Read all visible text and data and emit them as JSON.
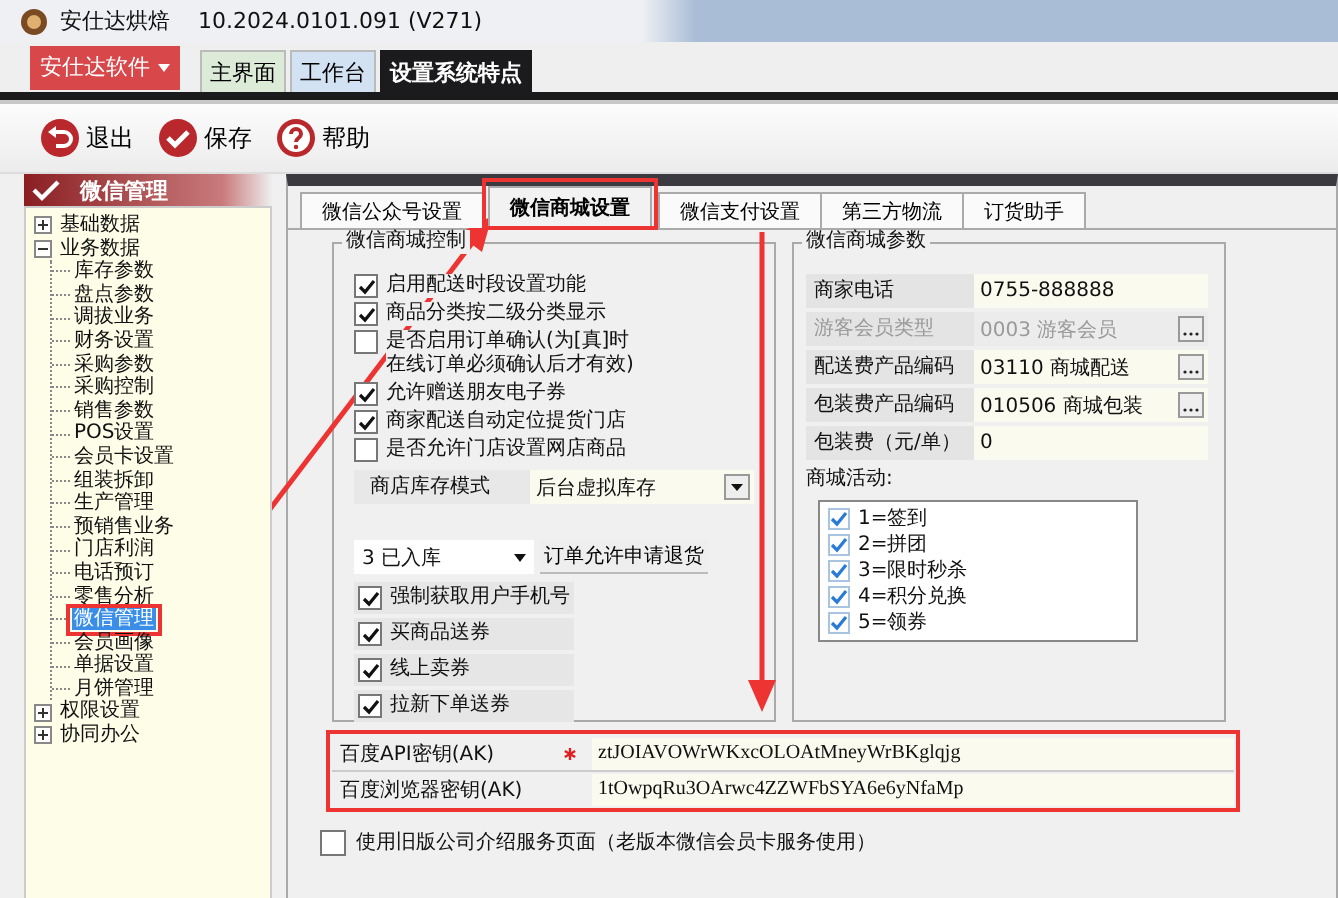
{
  "window": {
    "title": "安仕达烘焙",
    "version": "10.2024.0101.091 (V271)"
  },
  "app_menu": {
    "label": "安仕达软件"
  },
  "top_tabs": [
    {
      "label": "主界面",
      "selected": false
    },
    {
      "label": "工作台",
      "selected": false
    },
    {
      "label": "设置系统特点",
      "selected": true
    }
  ],
  "toolbar": [
    {
      "label": "退出",
      "kind": "exit"
    },
    {
      "label": "保存",
      "kind": "save"
    },
    {
      "label": "帮助",
      "kind": "help"
    }
  ],
  "sidebar": {
    "title": "微信管理",
    "tree": [
      {
        "label": "基础数据",
        "expanded": false,
        "selected": false
      },
      {
        "label": "业务数据",
        "expanded": true,
        "selected": false,
        "children": [
          {
            "label": "库存参数",
            "selected": false
          },
          {
            "label": "盘点参数",
            "selected": false
          },
          {
            "label": "调拔业务",
            "selected": false
          },
          {
            "label": "财务设置",
            "selected": false
          },
          {
            "label": "采购参数",
            "selected": false
          },
          {
            "label": "采购控制",
            "selected": false
          },
          {
            "label": "销售参数",
            "selected": false
          },
          {
            "label": "POS设置",
            "selected": false
          },
          {
            "label": "会员卡设置",
            "selected": false
          },
          {
            "label": "组装拆卸",
            "selected": false
          },
          {
            "label": "生产管理",
            "selected": false
          },
          {
            "label": "预销售业务",
            "selected": false
          },
          {
            "label": "门店利润",
            "selected": false
          },
          {
            "label": "电话预订",
            "selected": false
          },
          {
            "label": "零售分析",
            "selected": false
          },
          {
            "label": "微信管理",
            "selected": true
          },
          {
            "label": "会员画像",
            "selected": false
          },
          {
            "label": "单据设置",
            "selected": false
          },
          {
            "label": "月饼管理",
            "selected": false
          }
        ]
      },
      {
        "label": "权限设置",
        "expanded": false,
        "selected": false
      },
      {
        "label": "协同办公",
        "expanded": false,
        "selected": false
      }
    ]
  },
  "tabs": [
    {
      "label": "微信公众号设置",
      "selected": false
    },
    {
      "label": "微信商城设置",
      "selected": true
    },
    {
      "label": "微信支付设置",
      "selected": false
    },
    {
      "label": "第三方物流",
      "selected": false
    },
    {
      "label": "订货助手",
      "selected": false
    }
  ],
  "mall_control": {
    "title": "微信商城控制",
    "options": [
      {
        "label": "启用配送时段设置功能",
        "checked": true
      },
      {
        "label": "商品分类按二级分类显示",
        "checked": true
      },
      {
        "label": "是否启用订单确认(为[真]时在线订单必须确认后才有效)",
        "checked": false
      },
      {
        "label": "允许赠送朋友电子券",
        "checked": true
      },
      {
        "label": "商家配送自动定位提货门店",
        "checked": true
      },
      {
        "label": "是否允许门店设置网店商品",
        "checked": false
      }
    ],
    "stock_mode": {
      "label": "商店库存模式",
      "value": "后台虚拟库存"
    },
    "return_status": {
      "value": "3 已入库",
      "button": "订单允许申请退货"
    },
    "coupon_options": [
      {
        "label": "强制获取用户手机号",
        "checked": true
      },
      {
        "label": "买商品送券",
        "checked": true
      },
      {
        "label": "线上卖券",
        "checked": true
      },
      {
        "label": "拉新下单送券",
        "checked": true
      }
    ]
  },
  "mall_params": {
    "title": "微信商城参数",
    "fields": [
      {
        "label": "商家电话",
        "value": "0755-888888",
        "disabled": false,
        "lookup": false
      },
      {
        "label": "游客会员类型",
        "value": "0003 游客会员",
        "disabled": true,
        "lookup": true
      },
      {
        "label": "配送费产品编码",
        "value": "03110 商城配送",
        "disabled": false,
        "lookup": true
      },
      {
        "label": "包装费产品编码",
        "value": "010506 商城包装",
        "disabled": false,
        "lookup": true
      },
      {
        "label": "包装费（元/单）",
        "value": "0",
        "disabled": false,
        "lookup": false
      }
    ],
    "activities_label": "商城活动:",
    "activities": [
      {
        "label": "1=签到",
        "checked": true
      },
      {
        "label": "2=拼团",
        "checked": true
      },
      {
        "label": "3=限时秒杀",
        "checked": true
      },
      {
        "label": "4=积分兑换",
        "checked": true
      },
      {
        "label": "5=领券",
        "checked": true
      }
    ]
  },
  "baidu_keys": [
    {
      "label": "百度API密钥(AK)",
      "required": true,
      "value": "ztJOIAVOWrWKxcOLOAtMneyWrBKglqjg"
    },
    {
      "label": "百度浏览器密钥(AK)",
      "required": false,
      "value": "1tOwpqRu3OArwc4ZZWFbSYA6e6yNfaMp"
    }
  ],
  "legacy_page": {
    "label": "使用旧版公司介绍服务页面（老版本微信会员卡服务使用）",
    "checked": false
  }
}
